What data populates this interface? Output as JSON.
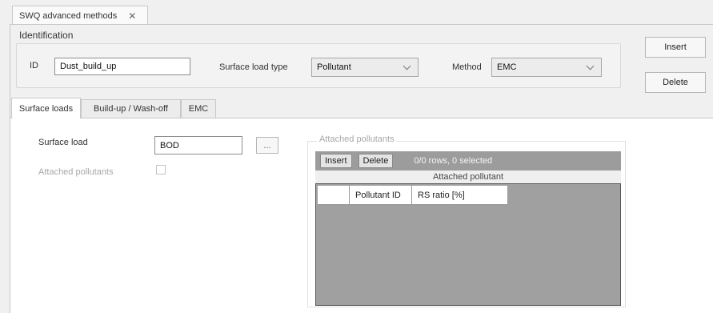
{
  "window_tab": {
    "title": "SWQ advanced methods",
    "close_glyph": "✕"
  },
  "identification": {
    "group_label": "Identification",
    "id_label": "ID",
    "id_value": "Dust_build_up",
    "surface_load_type_label": "Surface load type",
    "surface_load_type_value": "Pollutant",
    "method_label": "Method",
    "method_value": "EMC"
  },
  "actions": {
    "insert_label": "Insert",
    "delete_label": "Delete"
  },
  "tabs": [
    {
      "label": "Surface loads",
      "active": true
    },
    {
      "label": "Build-up / Wash-off",
      "active": false
    },
    {
      "label": "EMC",
      "active": false
    }
  ],
  "surface_loads": {
    "surface_load_label": "Surface load",
    "surface_load_value": "BOD",
    "browse_label": "...",
    "attached_pollutants_label": "Attached pollutants",
    "attached_pollutants_checked": false
  },
  "attached_grid": {
    "legend": "Attached pollutants",
    "insert_label": "Insert",
    "delete_label": "Delete",
    "status": "0/0 rows, 0 selected",
    "caption": "Attached pollutant",
    "columns": [
      "",
      "Pollutant ID",
      "RS ratio [%]"
    ],
    "rows": []
  }
}
